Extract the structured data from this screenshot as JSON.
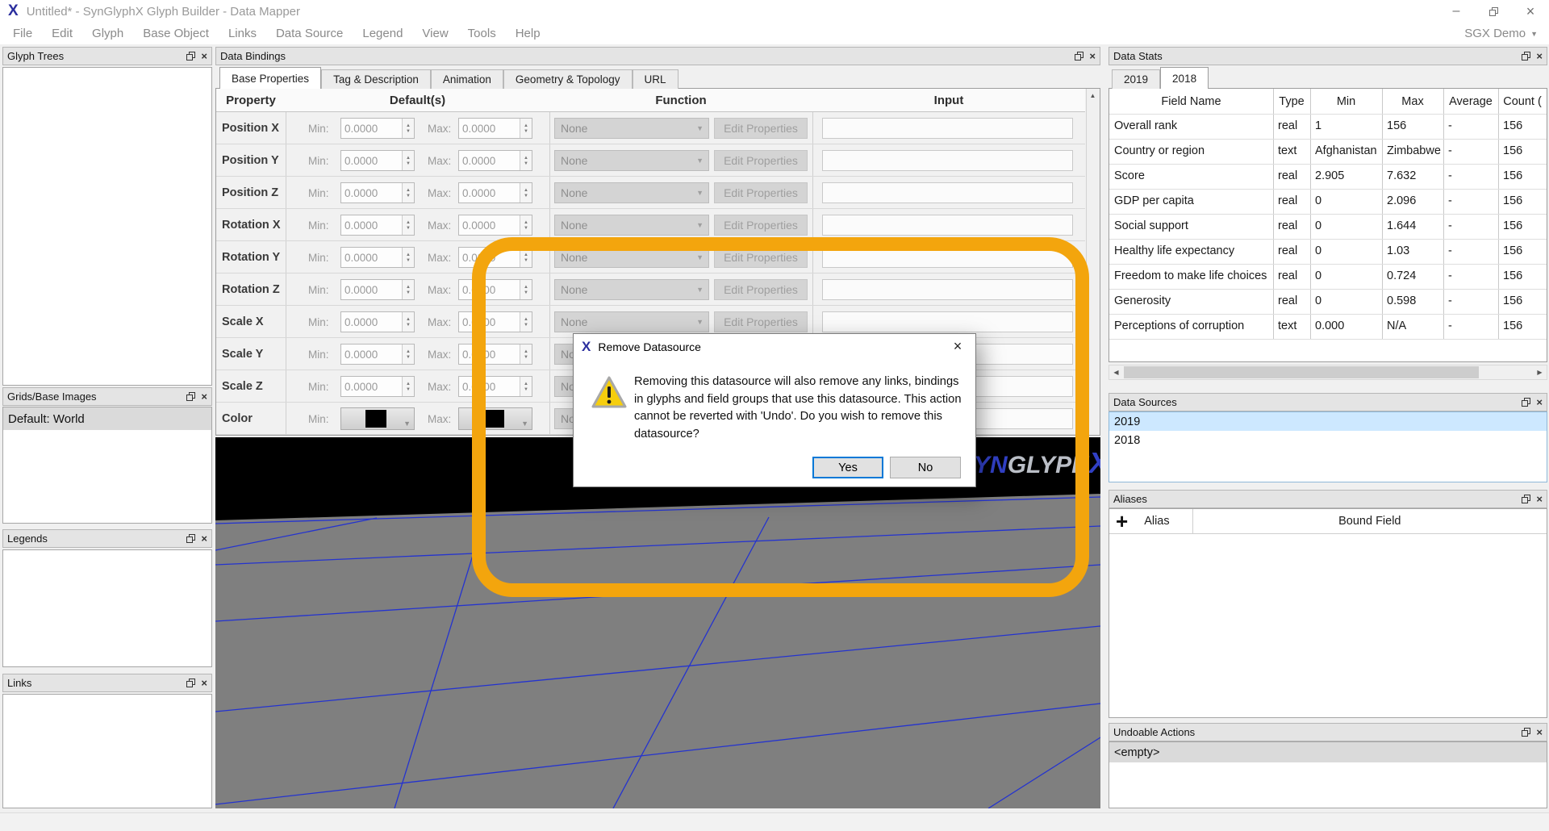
{
  "window": {
    "title": "Untitled* - SynGlyphX Glyph Builder - Data Mapper",
    "user_menu": "SGX Demo"
  },
  "menu_bar": {
    "items": [
      "File",
      "Edit",
      "Glyph",
      "Base Object",
      "Links",
      "Data Source",
      "Legend",
      "View",
      "Tools",
      "Help"
    ]
  },
  "panels": {
    "glyph_trees": {
      "title": "Glyph Trees"
    },
    "grids_base_images": {
      "title": "Grids/Base Images",
      "items": [
        "Default: World"
      ]
    },
    "legends": {
      "title": "Legends"
    },
    "links": {
      "title": "Links"
    },
    "data_bindings": {
      "title": "Data Bindings",
      "tabs": [
        "Base Properties",
        "Tag & Description",
        "Animation",
        "Geometry & Topology",
        "URL"
      ],
      "active_tab": "Base Properties",
      "columns": [
        "Property",
        "Default(s)",
        "Function",
        "Input"
      ],
      "min_label": "Min:",
      "max_label": "Max:",
      "function_value": "None",
      "edit_button": "Edit Properties",
      "rows": [
        {
          "property": "Position X",
          "min": "0.0000",
          "max": "0.0000"
        },
        {
          "property": "Position Y",
          "min": "0.0000",
          "max": "0.0000"
        },
        {
          "property": "Position Z",
          "min": "0.0000",
          "max": "0.0000"
        },
        {
          "property": "Rotation X",
          "min": "0.0000",
          "max": "0.0000"
        },
        {
          "property": "Rotation Y",
          "min": "0.0000",
          "max": "0.0000"
        },
        {
          "property": "Rotation Z",
          "min": "0.0000",
          "max": "0.0000"
        },
        {
          "property": "Scale X",
          "min": "0.0000",
          "max": "0.0000"
        },
        {
          "property": "Scale Y",
          "min": "0.0000",
          "max": "0.0000"
        },
        {
          "property": "Scale Z",
          "min": "0.0000",
          "max": "0.0000"
        },
        {
          "property": "Color",
          "color_min": "#000000",
          "color_max": "#000000"
        }
      ]
    },
    "data_stats": {
      "title": "Data Stats",
      "tabs": [
        "2019",
        "2018"
      ],
      "active_tab": "2018",
      "columns": [
        "Field Name",
        "Type",
        "Min",
        "Max",
        "Average",
        "Count ("
      ],
      "rows": [
        [
          "Overall rank",
          "real",
          "1",
          "156",
          "-",
          "156"
        ],
        [
          "Country or region",
          "text",
          "Afghanistan",
          "Zimbabwe",
          "-",
          "156"
        ],
        [
          "Score",
          "real",
          "2.905",
          "7.632",
          "-",
          "156"
        ],
        [
          "GDP per capita",
          "real",
          "0",
          "2.096",
          "-",
          "156"
        ],
        [
          "Social support",
          "real",
          "0",
          "1.644",
          "-",
          "156"
        ],
        [
          "Healthy life expectancy",
          "real",
          "0",
          "1.03",
          "-",
          "156"
        ],
        [
          "Freedom to make life choices",
          "real",
          "0",
          "0.724",
          "-",
          "156"
        ],
        [
          "Generosity",
          "real",
          "0",
          "0.598",
          "-",
          "156"
        ],
        [
          "Perceptions of corruption",
          "text",
          "0.000",
          "N/A",
          "-",
          "156"
        ]
      ]
    },
    "data_sources": {
      "title": "Data Sources",
      "items": [
        "2019",
        "2018"
      ],
      "selected": "2019"
    },
    "aliases": {
      "title": "Aliases",
      "columns": [
        "Alias",
        "Bound Field"
      ]
    },
    "undoable_actions": {
      "title": "Undoable Actions",
      "items": [
        "<empty>"
      ]
    }
  },
  "dialog": {
    "title": "Remove Datasource",
    "message": "Removing this datasource will also remove any links, bindings in glyphs and field groups that use this datasource. This action cannot be reverted with 'Undo'. Do you wish to remove this datasource?",
    "yes_label": "Yes",
    "no_label": "No"
  },
  "viewport": {
    "logo_parts": [
      "SYN",
      "GLYPH",
      "X"
    ]
  },
  "colors": {
    "annotation_orange": "#F3A50D",
    "selection_blue": "#cde8ff",
    "focus_blue": "#0078d7",
    "logo_blue": "#2b2f9e"
  }
}
